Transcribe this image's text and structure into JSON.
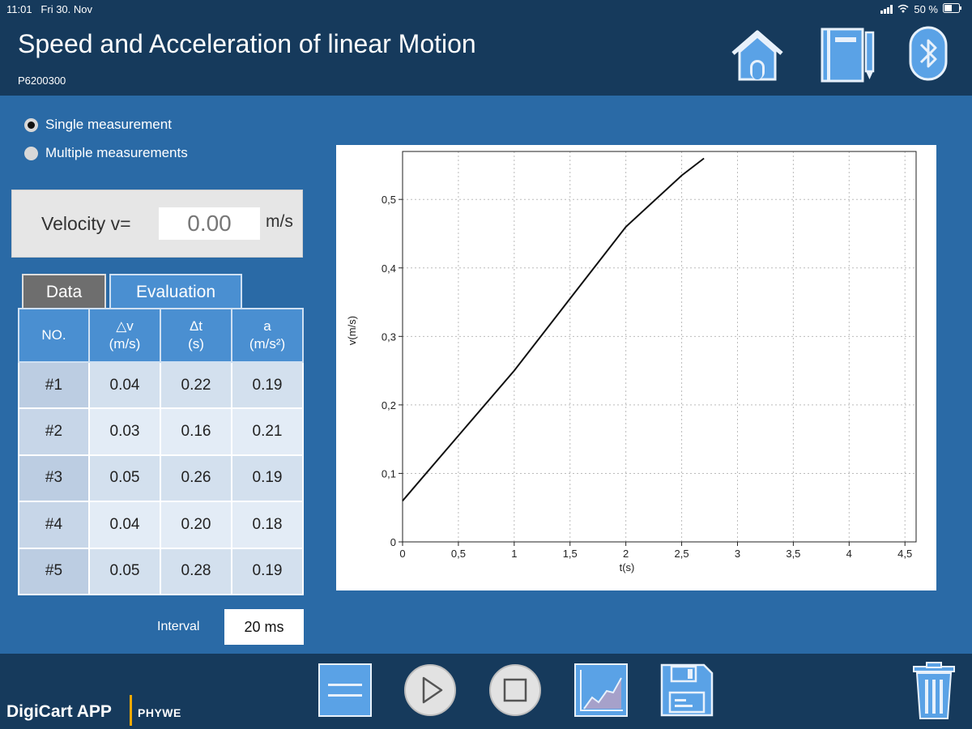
{
  "status": {
    "time": "11:01",
    "date": "Fri 30. Nov",
    "battery": "50 %"
  },
  "header": {
    "title": "Speed and Acceleration of linear Motion",
    "code": "P6200300",
    "icons": [
      "home-icon",
      "notebook-icon",
      "bluetooth-icon"
    ]
  },
  "mode": {
    "options": [
      "Single measurement",
      "Multiple measurements"
    ],
    "selected": "Single measurement"
  },
  "velocity": {
    "label": "Velocity v=",
    "value": "0.00",
    "unit": "m/s"
  },
  "tabs": [
    "Data",
    "Evaluation"
  ],
  "active_tab": "Evaluation",
  "table": {
    "headers": [
      {
        "line1": "NO.",
        "line2": ""
      },
      {
        "line1": "△v",
        "line2": "(m/s)"
      },
      {
        "line1": "Δt",
        "line2": "(s)"
      },
      {
        "line1": "a",
        "line2": "(m/s²)"
      }
    ],
    "rows": [
      [
        "#1",
        "0.04",
        "0.22",
        "0.19"
      ],
      [
        "#2",
        "0.03",
        "0.16",
        "0.21"
      ],
      [
        "#3",
        "0.05",
        "0.26",
        "0.19"
      ],
      [
        "#4",
        "0.04",
        "0.20",
        "0.18"
      ],
      [
        "#5",
        "0.05",
        "0.28",
        "0.19"
      ]
    ]
  },
  "interval": {
    "label": "Interval",
    "value": "20 ms"
  },
  "chart_data": {
    "type": "line",
    "xlabel": "t(s)",
    "ylabel": "v(m/s)",
    "xlim": [
      0,
      4.6
    ],
    "ylim": [
      0,
      0.57
    ],
    "xticks": [
      0,
      0.5,
      1,
      1.5,
      2,
      2.5,
      3,
      3.5,
      4,
      4.5
    ],
    "xtick_labels": [
      "0",
      "0,5",
      "1",
      "1,5",
      "2",
      "2,5",
      "3",
      "3,5",
      "4",
      "4,5"
    ],
    "yticks": [
      0,
      0.1,
      0.2,
      0.3,
      0.4,
      0.5
    ],
    "ytick_labels": [
      "0",
      "0,1",
      "0,2",
      "0,3",
      "0,4",
      "0,5"
    ],
    "grid": true,
    "series": [
      {
        "x": [
          0,
          0.5,
          1,
          1.5,
          2,
          2.5,
          2.7
        ],
        "y": [
          0.06,
          0.155,
          0.25,
          0.355,
          0.46,
          0.535,
          0.56
        ]
      }
    ]
  },
  "footer": {
    "brand": "DigiCart APP",
    "brand2": "PHYWE",
    "buttons": [
      "menu-icon",
      "play-icon",
      "stop-icon",
      "chart-icon",
      "save-icon",
      "trash-icon"
    ]
  },
  "colors": {
    "background": "#2a6aa6",
    "header": "#163a5c",
    "accent": "#4a8fd1",
    "brand_separator": "#f2a900"
  }
}
